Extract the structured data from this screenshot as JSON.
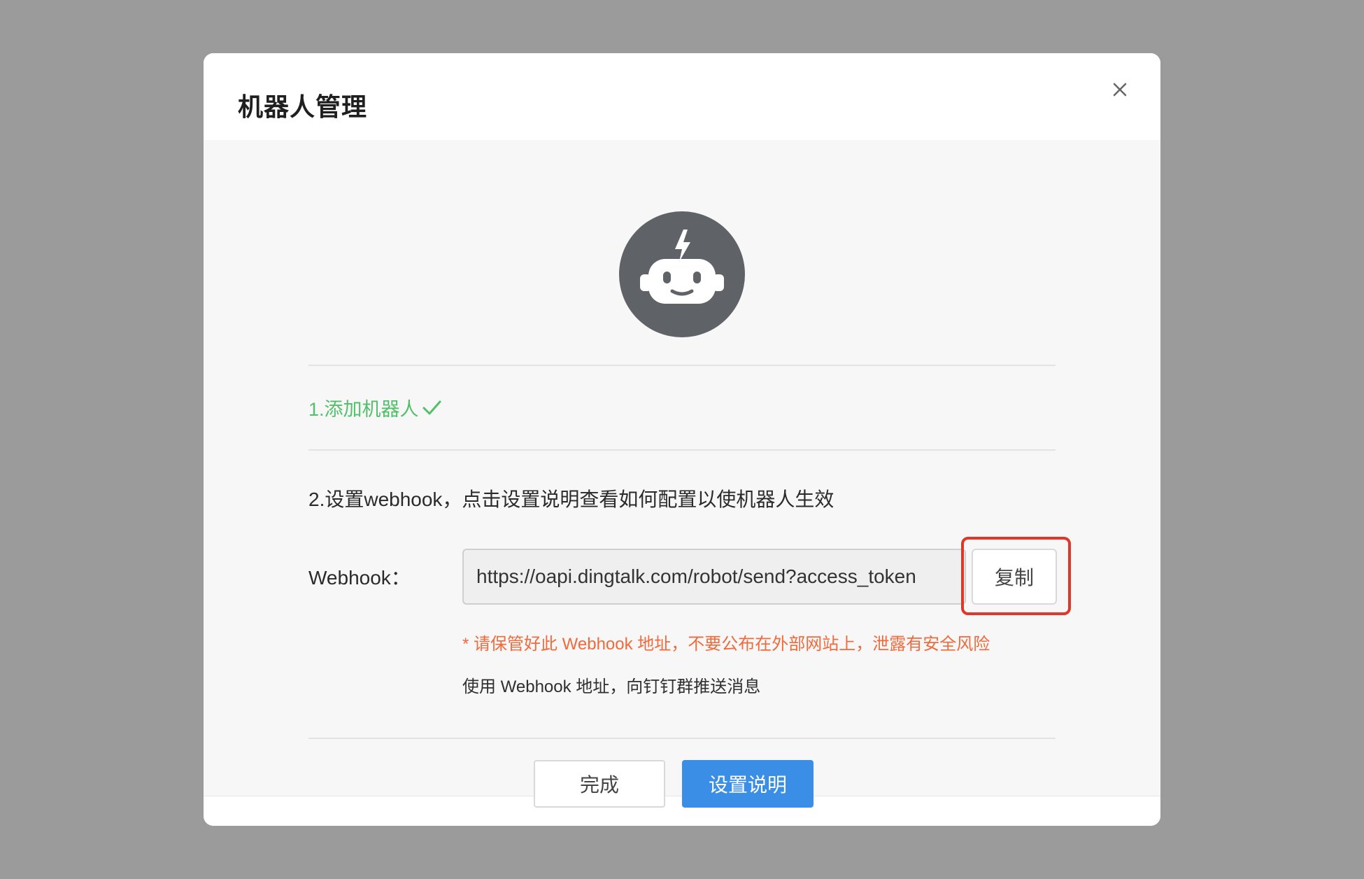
{
  "modal": {
    "title": "机器人管理",
    "close_icon": "close-icon"
  },
  "avatar": {
    "icon": "robot-icon",
    "color": "#5f6368"
  },
  "step1": {
    "label": "1.添加机器人",
    "status_icon": "checkmark-icon",
    "color": "#52c06a"
  },
  "step2": {
    "label": "2.设置webhook，点击设置说明查看如何配置以使机器人生效"
  },
  "webhook": {
    "label": "Webhook：",
    "value": "https://oapi.dingtalk.com/robot/send?access_token",
    "copy_label": "复制",
    "warning": "* 请保管好此 Webhook 地址，不要公布在外部网站上，泄露有安全风险",
    "hint": "使用 Webhook 地址，向钉钉群推送消息"
  },
  "footer": {
    "done_label": "完成",
    "help_label": "设置说明"
  },
  "colors": {
    "primary": "#3a8ee6",
    "warning": "#f06a3b",
    "highlight": "#e0372b"
  }
}
